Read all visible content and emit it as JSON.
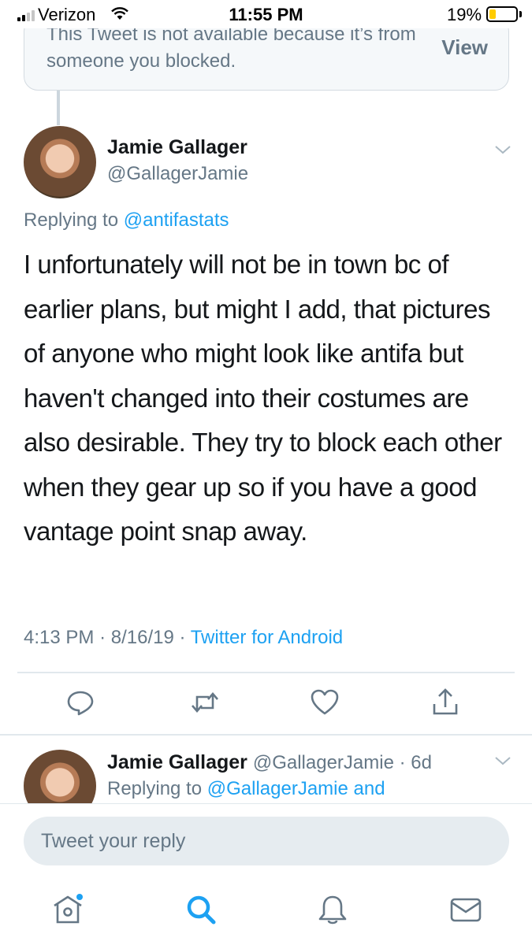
{
  "status_bar": {
    "carrier": "Verizon",
    "time": "11:55 PM",
    "battery_percent": "19%",
    "battery_level": 0.19
  },
  "blocked_tweet": {
    "message": "This Tweet is not available because it’s from someone you blocked.",
    "view_label": "View"
  },
  "main_tweet": {
    "display_name": "Jamie Gallager",
    "handle": "@GallagerJamie",
    "replying_prefix": "Replying to",
    "replying_to": "@antifastats",
    "text": "I unfortunately will not be in town bc of earlier plans,  but might I add, that pictures of anyone who might look like antifa but haven't changed into their costumes are also desirable. They try to block each other when they gear up so if you have a good vantage point snap away.",
    "time": "4:13 PM",
    "date": "8/16/19",
    "separator": "·",
    "source": "Twitter for Android"
  },
  "actions": [
    "reply-icon",
    "retweet-icon",
    "like-icon",
    "share-icon"
  ],
  "second_tweet": {
    "display_name": "Jamie Gallager",
    "handle": "@GallagerJamie",
    "age": "6d",
    "replying_prefix": "Replying to",
    "replying_to": "@GallagerJamie and"
  },
  "reply_bar": {
    "placeholder": "Tweet your reply"
  },
  "tabs": [
    "home-icon",
    "search-icon",
    "notifications-icon",
    "messages-icon"
  ],
  "colors": {
    "accent": "#1da1f2",
    "secondary_text": "#657786",
    "primary_text": "#14171a",
    "battery": "#ffcc00"
  }
}
